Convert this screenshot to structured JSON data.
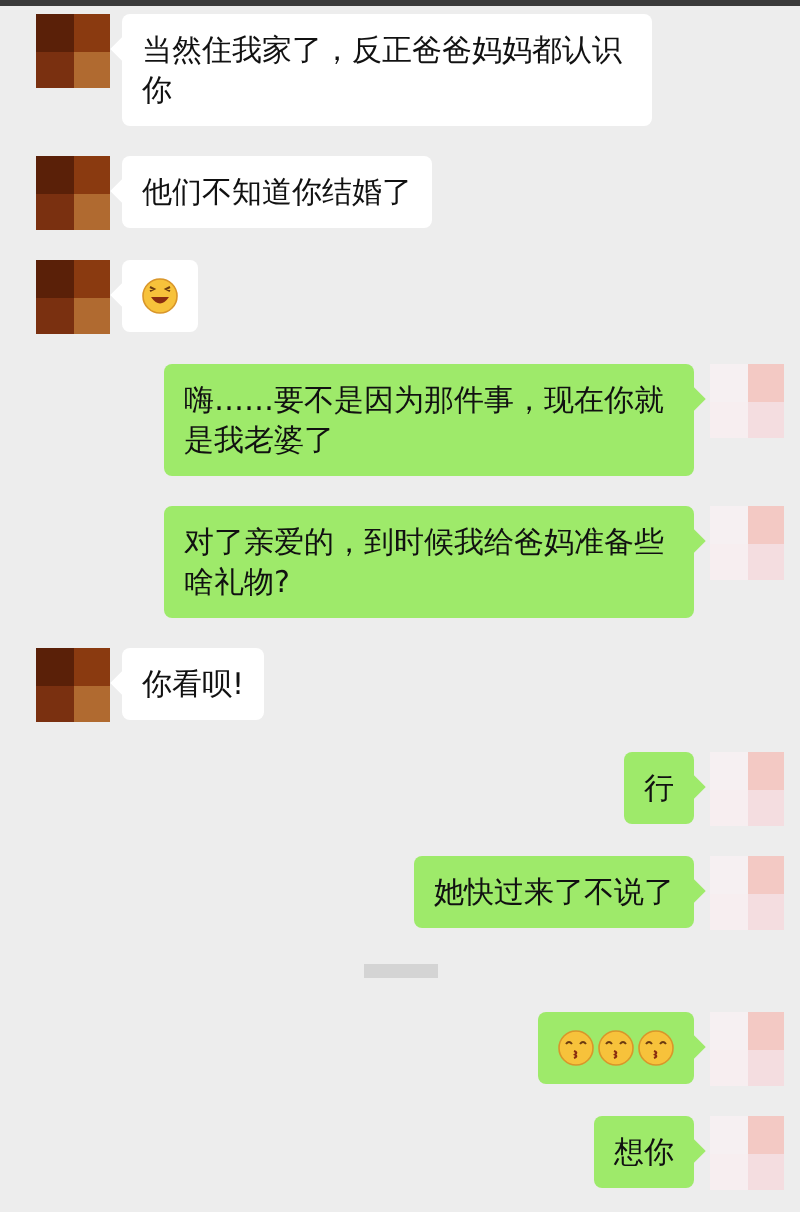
{
  "messages": [
    {
      "kind": "received",
      "text": "当然住我家了，反正爸爸妈妈都认识你"
    },
    {
      "kind": "received",
      "text": "他们不知道你结婚了"
    },
    {
      "kind": "received",
      "emojis": [
        {
          "kind": "laugh"
        }
      ]
    },
    {
      "kind": "sent",
      "text": "嗨……要不是因为那件事，现在你就是我老婆了"
    },
    {
      "kind": "sent",
      "text": "对了亲爱的，到时候我给爸妈准备些啥礼物?"
    },
    {
      "kind": "received",
      "text": "你看呗!"
    },
    {
      "kind": "sent",
      "text": "行"
    },
    {
      "kind": "sent",
      "text": "她快过来了不说了"
    },
    {
      "kind": "time"
    },
    {
      "kind": "sent",
      "emojis": [
        {
          "kind": "kiss"
        },
        {
          "kind": "kiss"
        },
        {
          "kind": "kiss"
        }
      ]
    },
    {
      "kind": "sent",
      "text": "想你"
    }
  ]
}
